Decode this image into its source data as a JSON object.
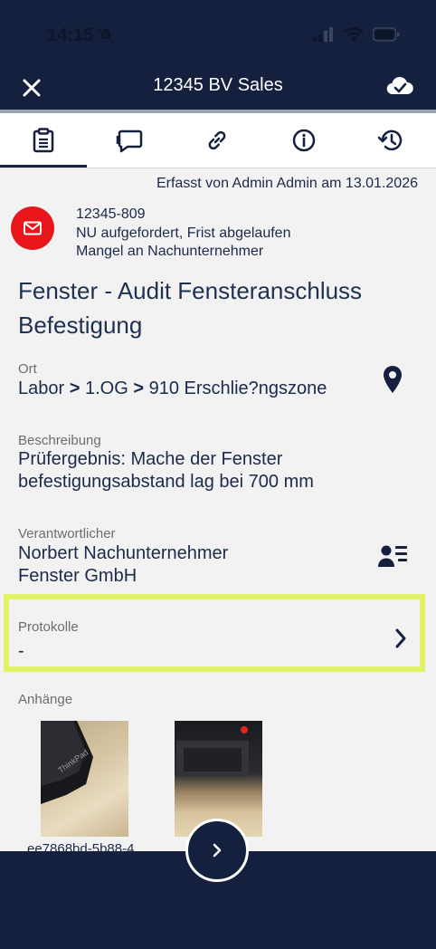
{
  "status_bar": {
    "time": "14:15"
  },
  "header": {
    "title": "12345 BV Sales"
  },
  "tabs": [
    {
      "name": "protocol",
      "icon": "clipboard-icon"
    },
    {
      "name": "comments",
      "icon": "chat-icon"
    },
    {
      "name": "links",
      "icon": "link-icon"
    },
    {
      "name": "info",
      "icon": "info-icon"
    },
    {
      "name": "history",
      "icon": "history-icon"
    }
  ],
  "meta": {
    "recorded_by": "Erfasst von Admin Admin am 13.01.2026"
  },
  "issue": {
    "number": "12345-809",
    "status": "NU aufgefordert, Frist abgelaufen",
    "category": "Mangel an Nachunternehmer",
    "title": "Fenster - Audit Fensteranschluss Befestigung",
    "status_color": "#e8161a"
  },
  "location": {
    "label": "Ort",
    "parts": [
      "Labor",
      "1.OG",
      "910 Erschlie?ngszone"
    ],
    "separator": ">"
  },
  "description": {
    "label": "Beschreibung",
    "line1": "Prüfergebnis: Mache der Fenster",
    "line2": "befestigungsabstand lag bei 700 mm"
  },
  "responsible": {
    "label": "Verantwortlicher",
    "name": "Norbert Nachunternehmer",
    "company": "Fenster GmbH"
  },
  "protocols": {
    "label": "Protokolle",
    "value": "-"
  },
  "attachments": {
    "label": "Anhänge",
    "first_filename": "ee7868bd-5b88-4"
  },
  "colors": {
    "primary": "#14203d",
    "highlight": "#e2f266",
    "accent_red": "#e8161a"
  }
}
